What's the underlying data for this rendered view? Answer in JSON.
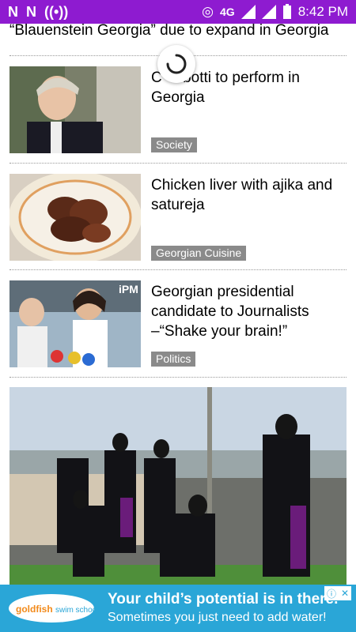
{
  "statusbar": {
    "network": "4G",
    "time": "8:42 PM",
    "left_icons": [
      "N",
      "N"
    ]
  },
  "articles": {
    "top_title": "“Blauenstein Georgia” due to expand in Georgia",
    "items": [
      {
        "title": "C     botti to perform in Georgia",
        "tag": "Society"
      },
      {
        "title": "Chicken liver with ajika and satureja",
        "tag": "Georgian Cuisine"
      },
      {
        "title": "Georgian presidential candidate to Journalists –“Shake your brain!”",
        "tag": "Politics"
      }
    ]
  },
  "ad": {
    "line1": "Your child’s potential is in there.",
    "line2": "Sometimes you just need to add water!",
    "brand": "goldfish swim school"
  },
  "colors": {
    "statusbar": "#8e1bd0",
    "tag_bg": "#8a8a8a",
    "ad_bg": "#2aa6d7"
  }
}
